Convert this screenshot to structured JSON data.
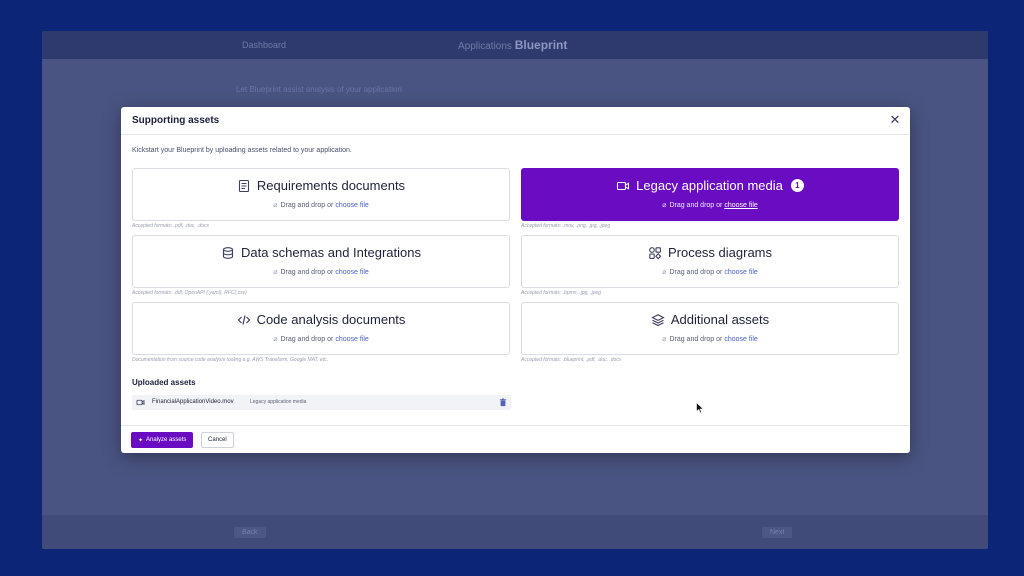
{
  "background_app": {
    "back_link": "Dashboard",
    "brand_prefix": "Applications",
    "brand_name": "Blueprint",
    "heading": "Let Blueprint assist analysis of your application",
    "back_button": "Back",
    "next_button": "Next"
  },
  "modal": {
    "title": "Supporting assets",
    "intro": "Kickstart your Blueprint by uploading assets related to your application.",
    "drop_text": "Drag and drop or",
    "choose_text": "choose file",
    "cards": [
      {
        "title": "Requirements documents",
        "icon": "document-icon",
        "formats": "Accepted formats: .pdf, .doc, .docx",
        "active": false
      },
      {
        "title": "Legacy application media",
        "icon": "video-camera-icon",
        "formats": "Accepted formats: .mov, .png, .jpg, .jpeg",
        "active": true,
        "badge": "1"
      },
      {
        "title": "Data schemas and Integrations",
        "icon": "database-icon",
        "formats": "Accepted formats: .ddl, OpenAPI (.yaml), RFC(.csv)",
        "active": false
      },
      {
        "title": "Process diagrams",
        "icon": "process-diagram-icon",
        "formats": "Accepted formats: .bpmn, .jpg, .jpeg",
        "active": false
      },
      {
        "title": "Code analysis documents",
        "icon": "code-icon",
        "formats": "Documentation from source code analysis tooling e.g. AWS Transform, Google MAT, etc.",
        "active": false
      },
      {
        "title": "Additional assets",
        "icon": "layers-icon",
        "formats": "Accepted formats: .blueprint, .pdf, .doc, .docx",
        "active": false
      }
    ],
    "uploaded": {
      "title": "Uploaded assets",
      "files": [
        {
          "name": "FinancialApplicationVideo.mov",
          "type": "Legacy application media"
        }
      ]
    },
    "footer": {
      "analyze_label": "Analyze assets",
      "cancel_label": "Cancel"
    }
  },
  "colors": {
    "backdrop": "#0c2576",
    "accent": "#6a0dc2",
    "link": "#4a5fc6"
  }
}
